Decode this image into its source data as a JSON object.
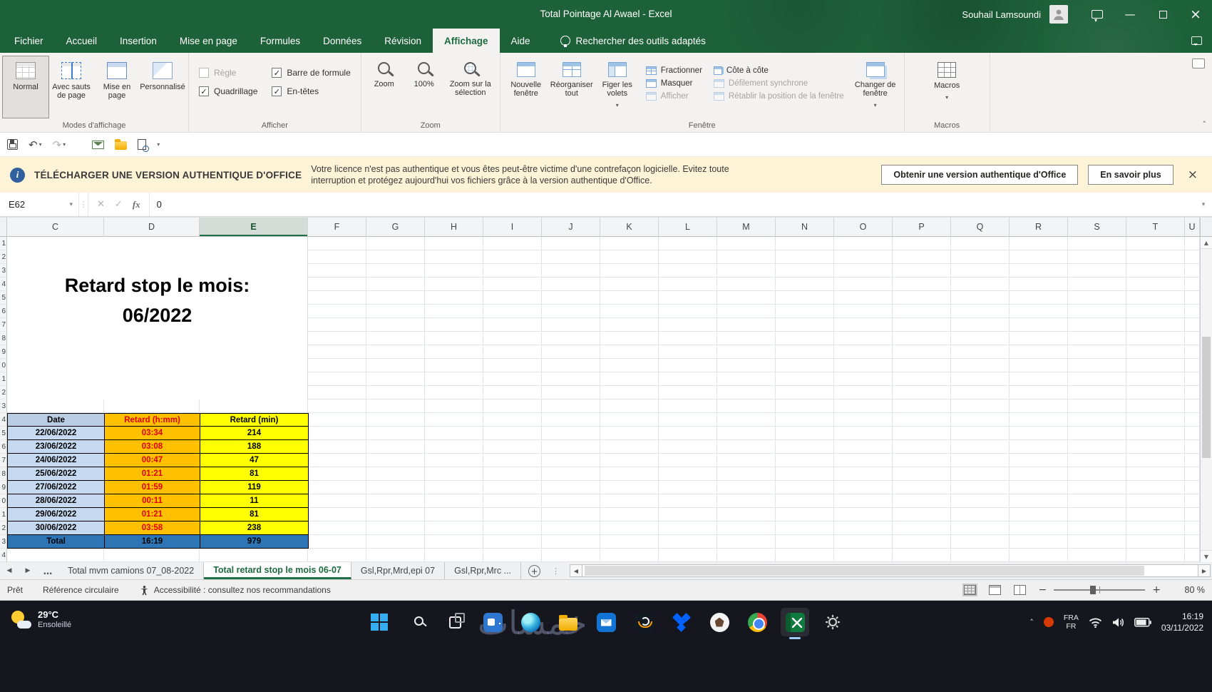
{
  "colors": {
    "title_green": "#1d6139",
    "excel_green": "#217346",
    "banner_bg": "#fdf3d7",
    "taskbar_bg": "#16161f",
    "date_header_bg": "#b8cce4",
    "date_bg": "#c5d9f1",
    "hmm_bg": "#ffc000",
    "hmm_text": "#e00000",
    "min_bg": "#ffff00",
    "total_bg": "#2e75b6"
  },
  "glyphs": {
    "chevron_down": "▾",
    "chevron_up": "˄",
    "close": "×",
    "minimize": "—",
    "left": "◀",
    "right": "▶",
    "up": "▲",
    "down": "▼",
    "ellipsis": "…",
    "dots": "⋮",
    "minus": "−",
    "plus": "+",
    "check": "✓",
    "cancel": "✕",
    "undo": "↶",
    "redo": "↷",
    "info": "i"
  },
  "title_bar": {
    "title": "Total Pointage Al Awael  -  Excel",
    "user": "Souhail Lamsoundi"
  },
  "ribbon": {
    "tabs": [
      {
        "label": "Fichier"
      },
      {
        "label": "Accueil"
      },
      {
        "label": "Insertion"
      },
      {
        "label": "Mise en page"
      },
      {
        "label": "Formules"
      },
      {
        "label": "Données"
      },
      {
        "label": "Révision"
      },
      {
        "label": "Affichage",
        "active": true
      },
      {
        "label": "Aide"
      }
    ],
    "search": "Rechercher des outils adaptés",
    "groups": {
      "modes": {
        "label": "Modes d'affichage",
        "buttons": [
          "Normal",
          "Avec sauts de page",
          "Mise en page",
          "Personnalisé"
        ]
      },
      "afficher": {
        "label": "Afficher",
        "checks": [
          {
            "label": "Règle",
            "checked": false,
            "disabled": true
          },
          {
            "label": "Quadrillage",
            "checked": true,
            "disabled": false
          },
          {
            "label": "Barre de formule",
            "checked": true,
            "disabled": false
          },
          {
            "label": "En-têtes",
            "checked": true,
            "disabled": false
          }
        ]
      },
      "zoom": {
        "label": "Zoom",
        "buttons": [
          "Zoom",
          "100%",
          "Zoom sur la sélection"
        ]
      },
      "fenetre": {
        "label": "Fenêtre",
        "big": [
          "Nouvelle fenêtre",
          "Réorganiser tout",
          "Figer les volets"
        ],
        "small": [
          {
            "label": "Fractionner",
            "disabled": false
          },
          {
            "label": "Masquer",
            "disabled": false
          },
          {
            "label": "Afficher",
            "disabled": true
          },
          {
            "label": "Côte à côte",
            "disabled": false
          },
          {
            "label": "Défilement synchrone",
            "disabled": true
          },
          {
            "label": "Rétablir la position de la fenêtre",
            "disabled": true
          }
        ],
        "change": "Changer de fenêtre"
      },
      "macros": {
        "label": "Macros",
        "button": "Macros"
      }
    }
  },
  "banner": {
    "title": "TÉLÉCHARGER UNE VERSION AUTHENTIQUE D'OFFICE",
    "message_line1": "Votre licence n'est pas authentique et vous êtes peut-être victime d'une contrefaçon logicielle. Evitez toute",
    "message_line2": "interruption et protégez aujourd'hui vos fichiers grâce à la version authentique d'Office.",
    "buttons": [
      "Obtenir une version authentique d'Office",
      "En savoir plus"
    ]
  },
  "formula_bar": {
    "name_box": "E62",
    "fx": "fx",
    "value": "0"
  },
  "spreadsheet": {
    "columns": [
      "C",
      "D",
      "E",
      "F",
      "G",
      "H",
      "I",
      "J",
      "K",
      "L",
      "M",
      "N",
      "O",
      "P",
      "Q",
      "R",
      "S",
      "T",
      "U"
    ],
    "selected_column": "E",
    "row_digits": [
      "1",
      "2",
      "3",
      "4",
      "5",
      "6",
      "7",
      "8",
      "9",
      "0",
      "1",
      "2",
      "3",
      "4",
      "5",
      "6",
      "7",
      "8",
      "9",
      "0",
      "1",
      "2",
      "3",
      "4"
    ],
    "title_line1": "Retard stop le mois:",
    "title_line2": "06/2022"
  },
  "table": {
    "headers": [
      "Date",
      "Retard (h:mm)",
      "Retard (min)"
    ],
    "rows": [
      [
        "22/06/2022",
        "03:34",
        "214"
      ],
      [
        "23/06/2022",
        "03:08",
        "188"
      ],
      [
        "24/06/2022",
        "00:47",
        "47"
      ],
      [
        "25/06/2022",
        "01:21",
        "81"
      ],
      [
        "27/06/2022",
        "01:59",
        "119"
      ],
      [
        "28/06/2022",
        "00:11",
        "11"
      ],
      [
        "29/06/2022",
        "01:21",
        "81"
      ],
      [
        "30/06/2022",
        "03:58",
        "238"
      ]
    ],
    "total": [
      "Total",
      "16:19",
      "979"
    ]
  },
  "sheet_tabs": {
    "more": "…",
    "tabs": [
      {
        "label": "Total mvm camions 07_08-2022"
      },
      {
        "label": "Total retard stop le mois 06-07",
        "active": true
      },
      {
        "label": "Gsl,Rpr,Mrd,epi 07"
      },
      {
        "label": "Gsl,Rpr,Mrc ..."
      }
    ]
  },
  "status_bar": {
    "ready": "Prêt",
    "circular": "Référence circulaire",
    "accessibility": "Accessibilité : consultez nos recommandations",
    "zoom": "80 %"
  },
  "taskbar": {
    "weather_temp": "29°C",
    "weather_desc": "Ensoleillé",
    "lang1": "FRA",
    "lang2": "FR",
    "time": "16:19",
    "date": "03/11/2022",
    "watermark": "خمسات"
  }
}
